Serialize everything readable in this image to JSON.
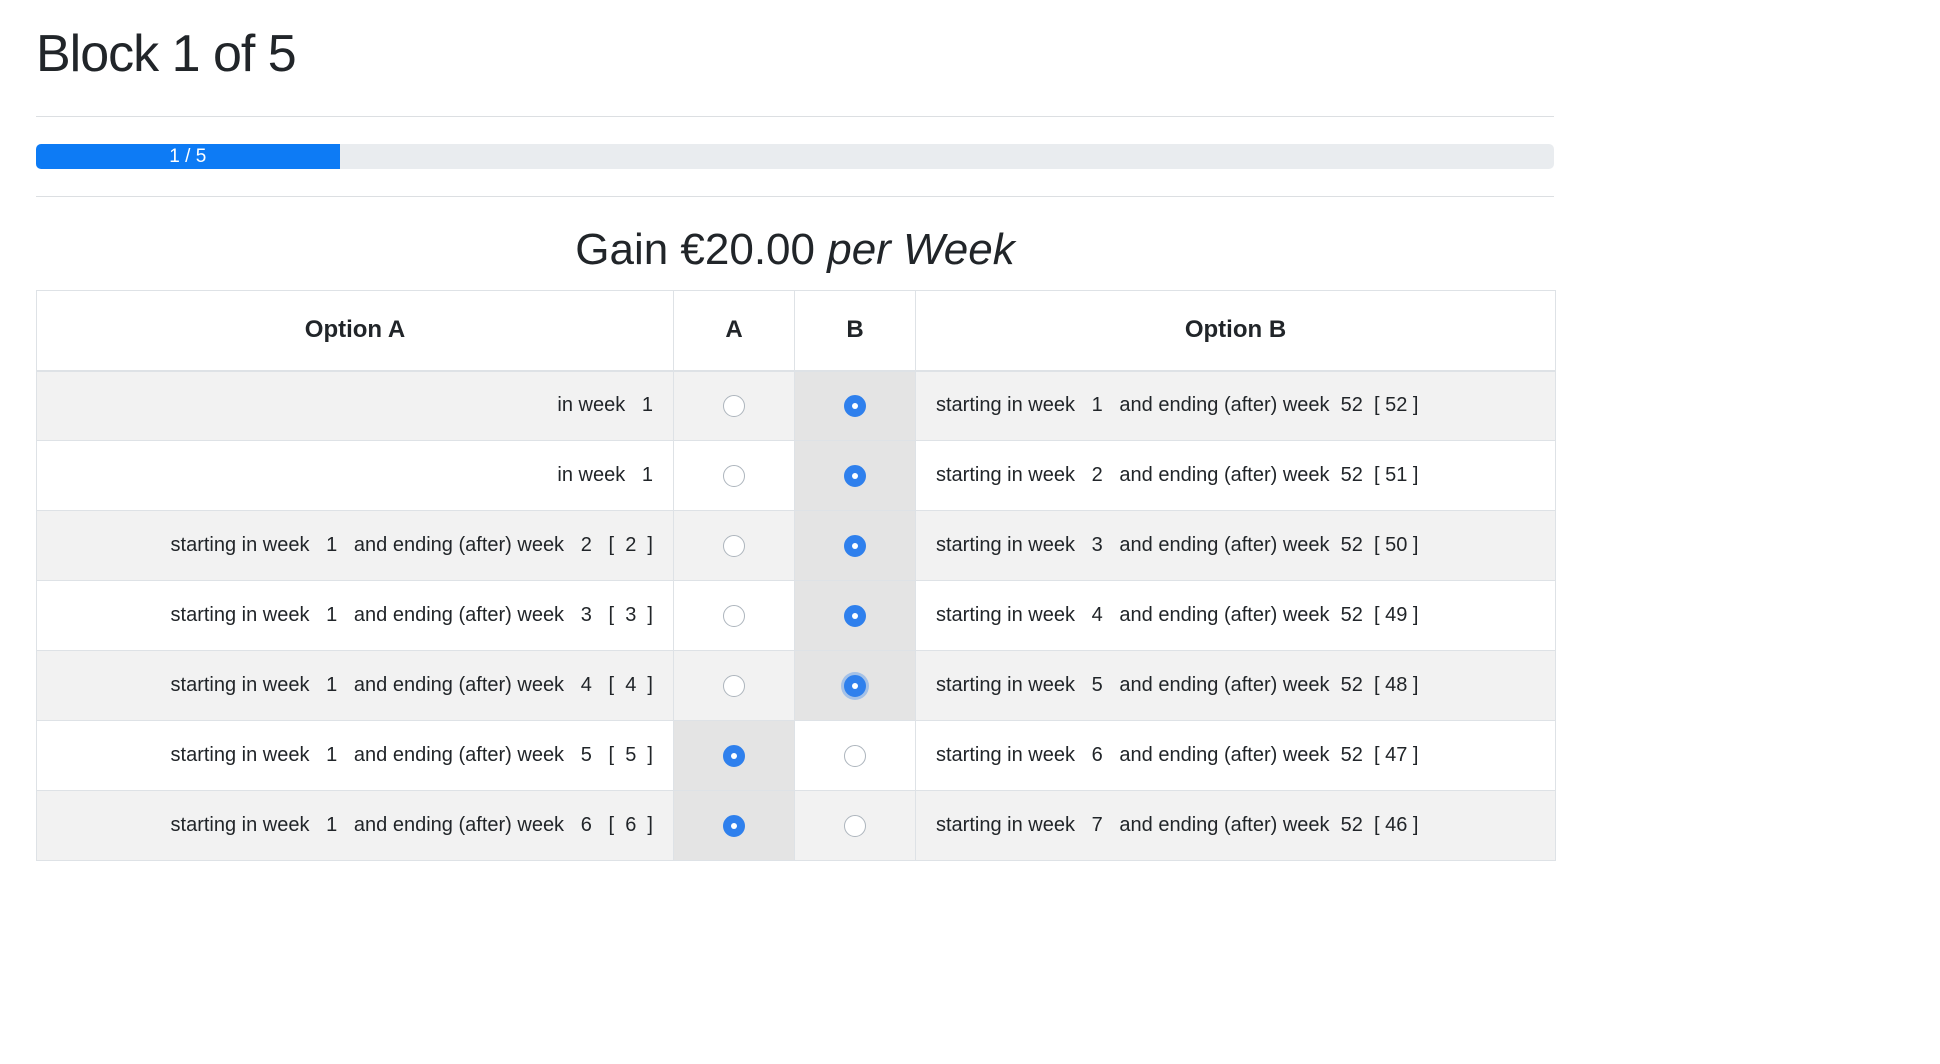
{
  "header": {
    "title": "Block 1 of 5"
  },
  "progress": {
    "label": "1 / 5",
    "value_fraction": 0.2,
    "color": "#0d7bf5"
  },
  "gain": {
    "amount": "Gain €20.00",
    "period": "per Week"
  },
  "table": {
    "headers": {
      "option_a": "Option A",
      "a": "A",
      "b": "B",
      "option_b": "Option B"
    },
    "rows": [
      {
        "option_a": "in week   1",
        "choice": "B",
        "option_b": "starting in week   1   and ending (after) week  52  [ 52 ]"
      },
      {
        "option_a": "in week   1",
        "choice": "B",
        "option_b": "starting in week   2   and ending (after) week  52  [ 51 ]"
      },
      {
        "option_a": "starting in week   1   and ending (after) week   2   [  2  ]",
        "choice": "B",
        "option_b": "starting in week   3   and ending (after) week  52  [ 50 ]"
      },
      {
        "option_a": "starting in week   1   and ending (after) week   3   [  3  ]",
        "choice": "B",
        "option_b": "starting in week   4   and ending (after) week  52  [ 49 ]"
      },
      {
        "option_a": "starting in week   1   and ending (after) week   4   [  4  ]",
        "choice": "B",
        "focused": true,
        "option_b": "starting in week   5   and ending (after) week  52  [ 48 ]"
      },
      {
        "option_a": "starting in week   1   and ending (after) week   5   [  5  ]",
        "choice": "A",
        "option_b": "starting in week   6   and ending (after) week  52  [ 47 ]"
      },
      {
        "option_a": "starting in week   1   and ending (after) week   6   [  6  ]",
        "choice": "A",
        "option_b": "starting in week   7   and ending (after) week  52  [ 46 ]"
      }
    ]
  },
  "colors": {
    "radio_checked": "#2f80ed",
    "selected_cell": "#e4e4e4",
    "striped_row": "#f2f2f2"
  }
}
